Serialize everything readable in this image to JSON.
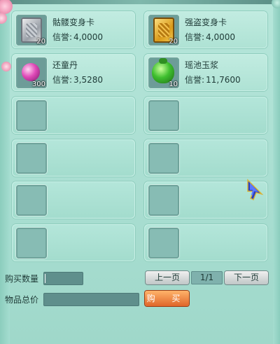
{
  "items": [
    {
      "name": "骷髅变身卡",
      "price_label": "信誉:",
      "price": "4,0000",
      "quantity": "20",
      "icon": "silver-card-icon"
    },
    {
      "name": "强盗变身卡",
      "price_label": "信誉:",
      "price": "4,0000",
      "quantity": "20",
      "icon": "gold-card-icon"
    },
    {
      "name": "还童丹",
      "price_label": "信誉:",
      "price": "3,5280",
      "quantity": "300",
      "icon": "pink-pill-icon"
    },
    {
      "name": "瑶池玉浆",
      "price_label": "信誉:",
      "price": "11,7600",
      "quantity": "10",
      "icon": "green-jar-icon"
    }
  ],
  "empty_slots_count": 8,
  "purchase": {
    "quantity_label": "购买数量",
    "total_label": "物品总价",
    "quantity_value": "",
    "total_value": "",
    "buy_label": "购 买"
  },
  "pagination": {
    "prev_label": "上一页",
    "next_label": "下一页",
    "page": "1/1"
  },
  "colors": {
    "panel": "#a5ddd0",
    "buy_button": "#e0662a",
    "field": "#5f8f8c"
  }
}
